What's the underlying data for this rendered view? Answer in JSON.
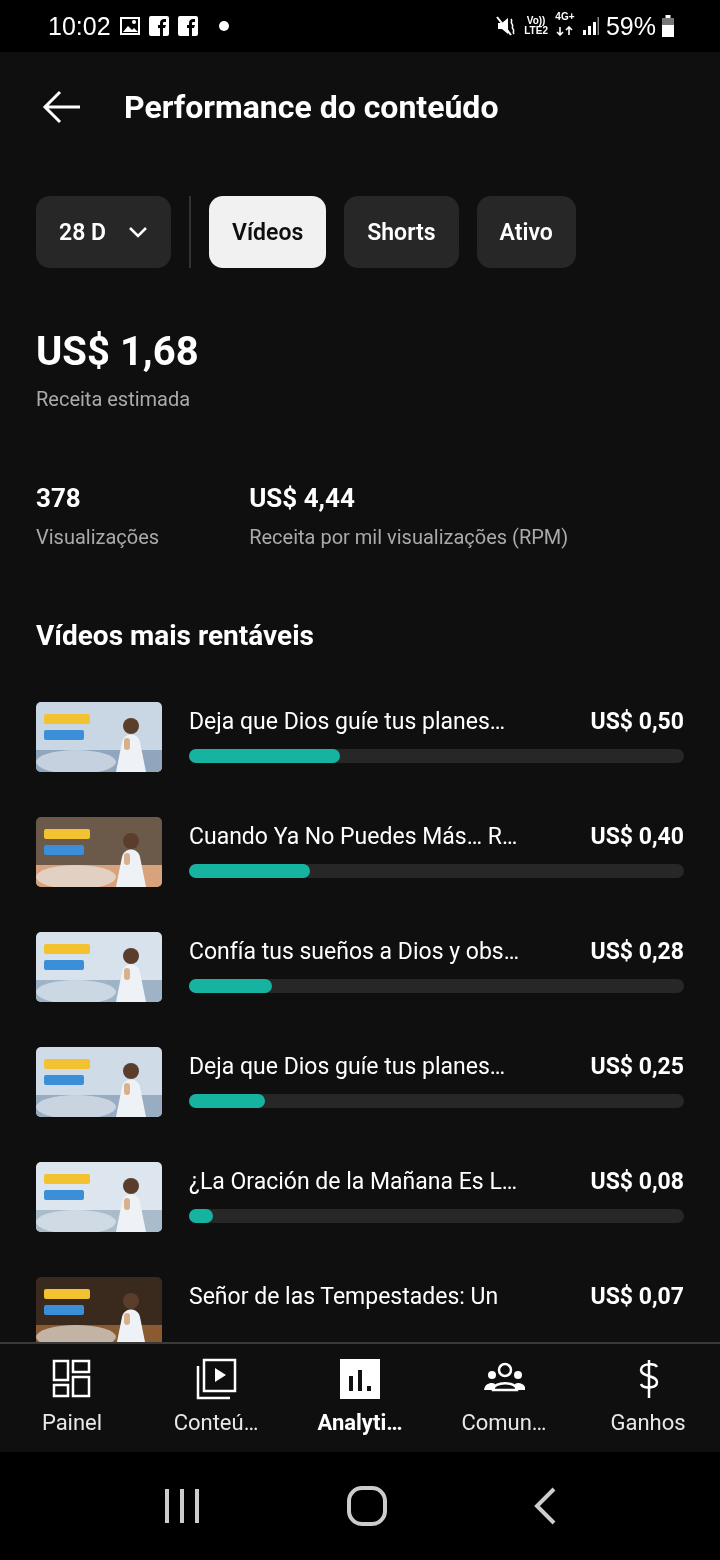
{
  "status_bar": {
    "time": "10:02",
    "volte": "Vo))",
    "lte": "LTE2",
    "network": "4G+",
    "battery": "59%"
  },
  "header": {
    "title": "Performance do conteúdo"
  },
  "filters": {
    "period": "28 D",
    "tabs": [
      {
        "label": "Vídeos",
        "selected": true
      },
      {
        "label": "Shorts",
        "selected": false
      },
      {
        "label": "Ativo",
        "selected": false
      }
    ]
  },
  "revenue": {
    "value": "US$ 1,68",
    "label": "Receita estimada"
  },
  "stats": [
    {
      "value": "378",
      "label": "Visualizações"
    },
    {
      "value": "US$ 4,44",
      "label": "Receita por mil visualizações (RPM)"
    }
  ],
  "top_videos": {
    "title": "Vídeos mais rentáveis",
    "rows": [
      {
        "title": "Deja que Dios guíe tus planes…",
        "amount": "US$ 0,50",
        "level": 0.305
      },
      {
        "title": "Cuando Ya No Puedes Más… R…",
        "amount": "US$ 0,40",
        "level": 0.244
      },
      {
        "title": "Confía tus sueños a Dios y obs…",
        "amount": "US$ 0,28",
        "level": 0.168
      },
      {
        "title": "Deja que Dios guíe tus planes…",
        "amount": "US$ 0,25",
        "level": 0.154
      },
      {
        "title": "¿La Oración de la Mañana Es L…",
        "amount": "US$ 0,08",
        "level": 0.048
      },
      {
        "title": "Señor de las Tempestades: Un",
        "amount": "US$ 0,07"
      }
    ]
  },
  "bottom_nav": [
    {
      "label": "Painel",
      "selected": false
    },
    {
      "label": "Conteú…",
      "selected": false
    },
    {
      "label": "Analyti…",
      "selected": true
    },
    {
      "label": "Comun…",
      "selected": false
    },
    {
      "label": "Ganhos",
      "selected": false
    }
  ]
}
